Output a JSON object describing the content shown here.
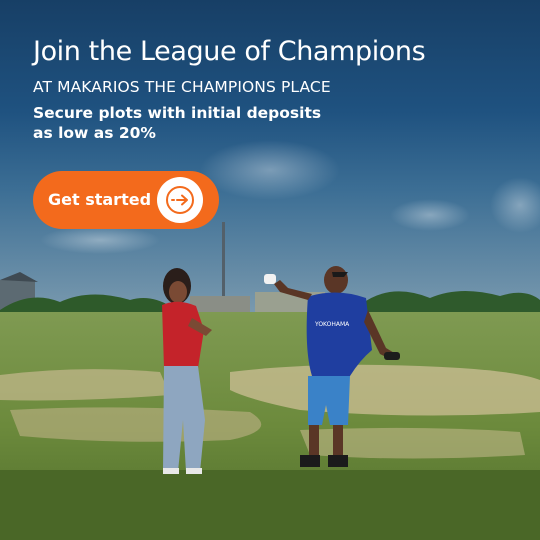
{
  "ad": {
    "headline": "Join the League of Champions",
    "subheadline": "AT MAKARIOS THE CHAMPIONS PLACE",
    "tagline_line1": "Secure plots with initial deposits",
    "tagline_line2": "as low as 20%",
    "cta_label": "Get started",
    "cta_icon": "arrow-right-circle-icon",
    "jersey_text": "YOKOHAMA"
  },
  "colors": {
    "accent": "#f36a1c",
    "text": "#ffffff",
    "sky": "#1d4a73",
    "grass": "#6d8f3a"
  }
}
